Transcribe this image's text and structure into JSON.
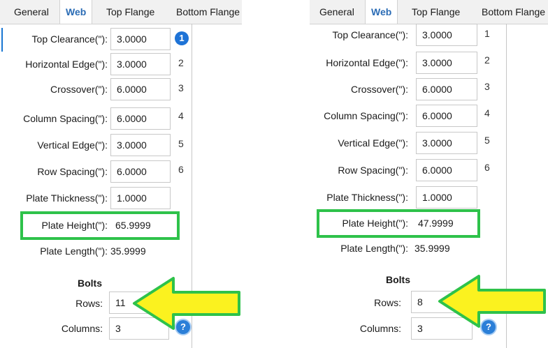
{
  "panels": [
    {
      "tabs": [
        "General",
        "Web",
        "Top Flange",
        "Bottom Flange"
      ],
      "active_tab": "Web",
      "fields": [
        {
          "label": "Top Clearance(\"):",
          "value": "3.0000",
          "marker": "1",
          "marker_style": "badge"
        },
        {
          "label": "Horizontal Edge(\"):",
          "value": "3.0000",
          "marker": "2"
        },
        {
          "label": "Crossover(\"):",
          "value": "6.0000",
          "marker": "3"
        },
        {
          "label": "Column Spacing(\"):",
          "value": "6.0000",
          "marker": "4"
        },
        {
          "label": "Vertical Edge(\"):",
          "value": "3.0000",
          "marker": "5"
        },
        {
          "label": "Row Spacing(\"):",
          "value": "6.0000",
          "marker": "6"
        },
        {
          "label": "Plate Thickness(\"):",
          "value": "1.0000",
          "marker": ""
        }
      ],
      "plate_height": {
        "label": "Plate Height(\"):",
        "value": "65.9999"
      },
      "plate_length": {
        "label": "Plate Length(\"):",
        "value": "35.9999"
      },
      "bolts": {
        "title": "Bolts",
        "rows_label": "Rows:",
        "rows_value": "11",
        "columns_label": "Columns:",
        "columns_value": "3"
      }
    },
    {
      "tabs": [
        "General",
        "Web",
        "Top Flange",
        "Bottom Flange"
      ],
      "active_tab": "Web",
      "fields": [
        {
          "label": "Top Clearance(\"):",
          "value": "3.0000",
          "marker": "1"
        },
        {
          "label": "Horizontal Edge(\"):",
          "value": "3.0000",
          "marker": "2"
        },
        {
          "label": "Crossover(\"):",
          "value": "6.0000",
          "marker": "3"
        },
        {
          "label": "Column Spacing(\"):",
          "value": "6.0000",
          "marker": "4"
        },
        {
          "label": "Vertical Edge(\"):",
          "value": "3.0000",
          "marker": "5"
        },
        {
          "label": "Row Spacing(\"):",
          "value": "6.0000",
          "marker": "6"
        },
        {
          "label": "Plate Thickness(\"):",
          "value": "1.0000",
          "marker": ""
        }
      ],
      "plate_height": {
        "label": "Plate Height(\"):",
        "value": "47.9999"
      },
      "plate_length": {
        "label": "Plate Length(\"):",
        "value": "35.9999"
      },
      "bolts": {
        "title": "Bolts",
        "rows_label": "Rows:",
        "rows_value": "8",
        "columns_label": "Columns:",
        "columns_value": "3"
      }
    }
  ],
  "help_icon_glyph": "?",
  "colors": {
    "highlight": "#2ec24a",
    "arrow_fill": "#fbf21f",
    "arrow_stroke": "#2ec24a",
    "accent": "#2b6cb5"
  }
}
